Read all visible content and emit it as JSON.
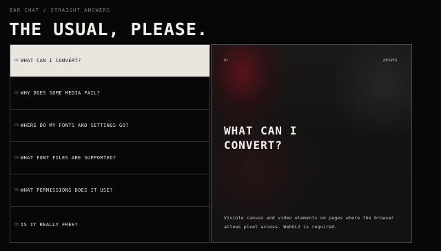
{
  "page": {
    "eyebrow": "BAR CHAT / STRAIGHT ANSWERS",
    "headline": "THE USUAL, PLEASE."
  },
  "faq": {
    "items": [
      {
        "num": "01",
        "question": "WHAT CAN I CONVERT?"
      },
      {
        "num": "02",
        "question": "WHY DOES SOME MEDIA FAIL?"
      },
      {
        "num": "03",
        "question": "WHERE DO MY FONTS AND SETTINGS GO?"
      },
      {
        "num": "04",
        "question": "WHAT FONT FILES ARE SUPPORTED?"
      },
      {
        "num": "05",
        "question": "WHAT PERMISSIONS DOES IT USE?"
      },
      {
        "num": "06",
        "question": "IS IT REALLY FREE?"
      }
    ]
  },
  "answer": {
    "num": "01",
    "tag": "ANSWER",
    "title": "WHAT CAN I CONVERT?",
    "body": "Visible canvas and video elements on pages where the browser allows pixel access. WebGL2 is required."
  },
  "colors": {
    "background": "#070707",
    "active_row": "#e8e6df",
    "accent_red": "#6e121a"
  }
}
